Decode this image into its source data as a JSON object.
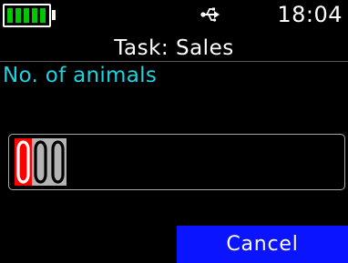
{
  "status_bar": {
    "battery": {
      "level_bars": 5,
      "max_bars": 5,
      "color": "#00c800",
      "icon": "battery-icon"
    },
    "usb_icon": "usb-icon",
    "time": "18:04"
  },
  "header": {
    "title": "Task: Sales"
  },
  "prompt": {
    "label": "No. of animals",
    "color": "#1fd3e0"
  },
  "entry": {
    "digits": [
      "0",
      "0",
      "0"
    ],
    "active_index": 0,
    "active_color": "#ff0000",
    "inactive_color": "#b4b4b4"
  },
  "softkeys": {
    "right_label": "Cancel",
    "right_color": "#0a14ff"
  }
}
